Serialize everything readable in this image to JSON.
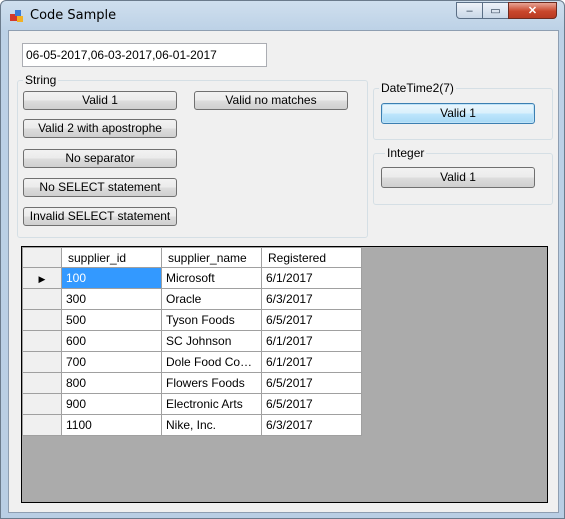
{
  "window": {
    "title": "Code Sample",
    "min_glyph": "‒",
    "max_glyph": "▭",
    "close_glyph": "✕"
  },
  "textbox": {
    "value": "06-05-2017,06-03-2017,06-01-2017"
  },
  "string_group": {
    "label": "String",
    "buttons": [
      "Valid 1",
      "Valid no matches",
      "Valid 2 with apostrophe",
      "No separator",
      "No SELECT statement",
      "Invalid SELECT statement"
    ]
  },
  "datetime_group": {
    "label": "DateTime2(7)",
    "button": "Valid 1"
  },
  "integer_group": {
    "label": "Integer",
    "button": "Valid 1"
  },
  "grid": {
    "columns": [
      "supplier_id",
      "supplier_name",
      "Registered"
    ],
    "current_row_glyph": "▶",
    "rows": [
      [
        "100",
        "Microsoft",
        "6/1/2017"
      ],
      [
        "300",
        "Oracle",
        "6/3/2017"
      ],
      [
        "500",
        "Tyson Foods",
        "6/5/2017"
      ],
      [
        "600",
        "SC Johnson",
        "6/1/2017"
      ],
      [
        "700",
        "Dole Food Comp...",
        "6/1/2017"
      ],
      [
        "800",
        "Flowers Foods",
        "6/5/2017"
      ],
      [
        "900",
        "Electronic Arts",
        "6/5/2017"
      ],
      [
        "1100",
        "Nike, Inc.",
        "6/3/2017"
      ]
    ]
  },
  "colors": {
    "selection": "#3399ff",
    "grid_background": "#ababab",
    "focus_border": "#3c7fb1"
  }
}
